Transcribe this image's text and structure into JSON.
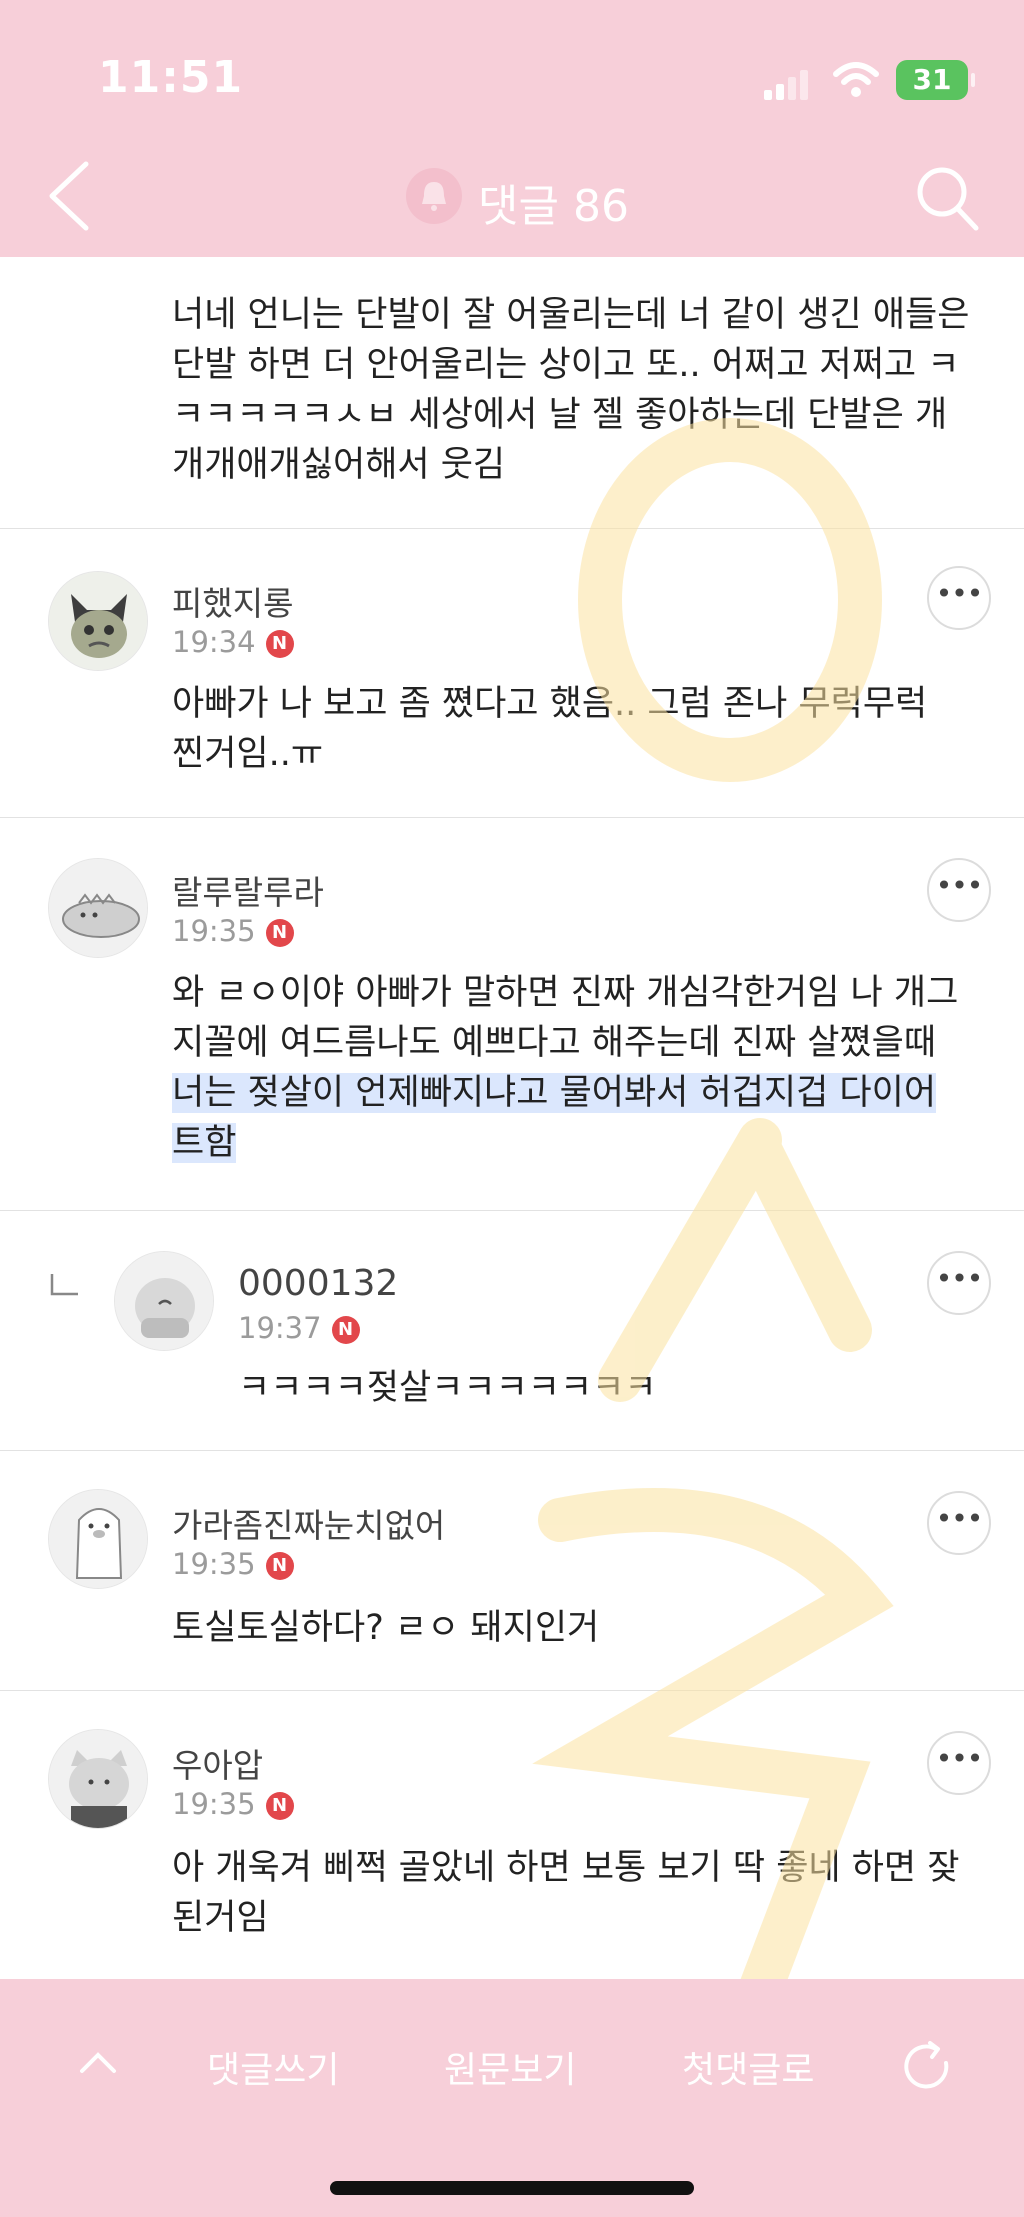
{
  "status_bar": {
    "time": "11:51",
    "battery": "31"
  },
  "header": {
    "title": "댓글 86"
  },
  "first_comment_tail": "너네 언니는 단발이 잘 어울리는데 너 같이 생긴 애들은 단발 하면 더 안어울리는 상이고 또.. 어쩌고 저쩌고 ㅋㅋㅋㅋㅋㅋㅅㅂ 세상에서 날 젤 좋아하는데 단발은 개개개애개싫어해서 웃김",
  "comments": [
    {
      "nick": "피했지롱",
      "time": "19:34",
      "badge": "N",
      "lines": [
        "아빠가 나 보고 좀 쪘다고 했음.. 그럼 존나 무럭무럭",
        "찐거임..ㅠ"
      ]
    },
    {
      "nick": "랄루랄루라",
      "time": "19:35",
      "badge": "N",
      "lines": [
        "와 ㄹㅇ이야 아빠가 말하면 진짜 개심각한거임 나 개그",
        "지꼴에 여드름나도 예쁘다고 해주는데 진짜 살쪘을때",
        "너는 젖살이 언제빠지냐고 물어봐서 허겁지겁 다이어",
        "트함"
      ]
    },
    {
      "nick": "0000132",
      "time": "19:37",
      "badge": "N",
      "lines": [
        "ㅋㅋㅋㅋ젖살ㅋㅋㅋㅋㅋㅋㅋ"
      ]
    },
    {
      "nick": "가라좀진짜눈치없어",
      "time": "19:35",
      "badge": "N",
      "lines": [
        "토실토실하다? ㄹㅇ 돼지인거"
      ]
    },
    {
      "nick": "우아압",
      "time": "19:35",
      "badge": "N",
      "lines": [
        "아 개욱겨 삐쩍 골았네 하면 보통 보기 딱 좋네 하면 잦",
        "된거임"
      ]
    }
  ],
  "more_label": "•••",
  "bottom_bar": {
    "write": "댓글쓰기",
    "original": "원문보기",
    "first": "첫댓글로"
  },
  "colors": {
    "brand_pink": "#f7cfd9",
    "badge_red": "#e2474b",
    "highlight": "#dbe7fd"
  }
}
